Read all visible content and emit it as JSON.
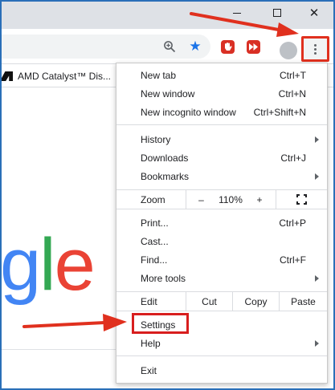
{
  "window": {
    "minimize_icon": "minimize-icon",
    "maximize_icon": "maximize-icon",
    "close_glyph": "✕"
  },
  "toolbar": {
    "star_glyph": "★",
    "icons": [
      "zoom-icon",
      "star-icon",
      "extension-icon",
      "extension-icon",
      "avatar",
      "more-menu-icon"
    ]
  },
  "bookmarks": {
    "items": [
      {
        "label": "AMD Catalyst™ Dis..."
      }
    ]
  },
  "page": {
    "logo_letters": [
      "g",
      "l",
      "e"
    ]
  },
  "menu": {
    "group1": [
      {
        "label": "New tab",
        "shortcut": "Ctrl+T"
      },
      {
        "label": "New window",
        "shortcut": "Ctrl+N"
      },
      {
        "label": "New incognito window",
        "shortcut": "Ctrl+Shift+N"
      }
    ],
    "group2": [
      {
        "label": "History",
        "shortcut": ""
      },
      {
        "label": "Downloads",
        "shortcut": "Ctrl+J"
      },
      {
        "label": "Bookmarks",
        "shortcut": ""
      }
    ],
    "zoom": {
      "label": "Zoom",
      "minus": "–",
      "value": "110%",
      "plus": "+"
    },
    "group3": [
      {
        "label": "Print...",
        "shortcut": "Ctrl+P"
      },
      {
        "label": "Cast...",
        "shortcut": ""
      },
      {
        "label": "Find...",
        "shortcut": "Ctrl+F"
      },
      {
        "label": "More tools",
        "shortcut": ""
      }
    ],
    "edit": {
      "label": "Edit",
      "cut": "Cut",
      "copy": "Copy",
      "paste": "Paste"
    },
    "group4": [
      {
        "label": "Settings",
        "shortcut": ""
      },
      {
        "label": "Help",
        "shortcut": ""
      }
    ],
    "exit": {
      "label": "Exit"
    }
  },
  "annotations": {
    "highlight_color": "#d81e1e",
    "accent_blue": "#1a73e8",
    "frame_color": "#2a6fb8"
  }
}
